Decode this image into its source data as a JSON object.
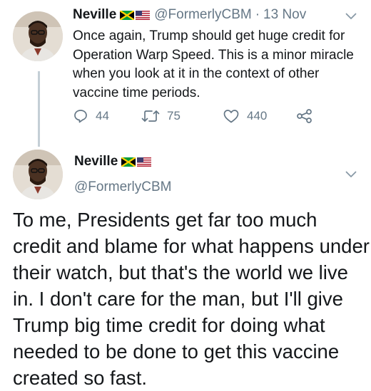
{
  "tweet1": {
    "name": "Neville",
    "handle": "@FormerlyCBM",
    "separator": "·",
    "date": "13 Nov",
    "text": "Once again, Trump should get huge credit for Operation Warp Speed. This is a minor miracle when you look at it in the context of other vaccine time periods.",
    "actions": {
      "replies": "44",
      "retweets": "75",
      "likes": "440"
    }
  },
  "tweet2": {
    "name": "Neville",
    "handle": "@FormerlyCBM",
    "text": "To me, Presidents get far too much credit and blame for what happens under their watch, but that's the world we live in. I don't care for the man, but I'll give Trump big time credit for doing what needed to be done to get this vaccine created so fast."
  },
  "icons": {
    "flags": [
      "jamaica-flag-icon",
      "usa-flag-icon"
    ],
    "actions": [
      "reply-icon",
      "retweet-icon",
      "like-icon",
      "share-icon"
    ],
    "menu": "chevron-down-icon"
  },
  "colors": {
    "text": "#14171a",
    "muted": "#657786",
    "thread_line": "#c4cfd6",
    "jamaica_green": "#009b3a",
    "jamaica_gold": "#fed100",
    "usa_red": "#b22234",
    "usa_blue": "#3c3b6e"
  }
}
